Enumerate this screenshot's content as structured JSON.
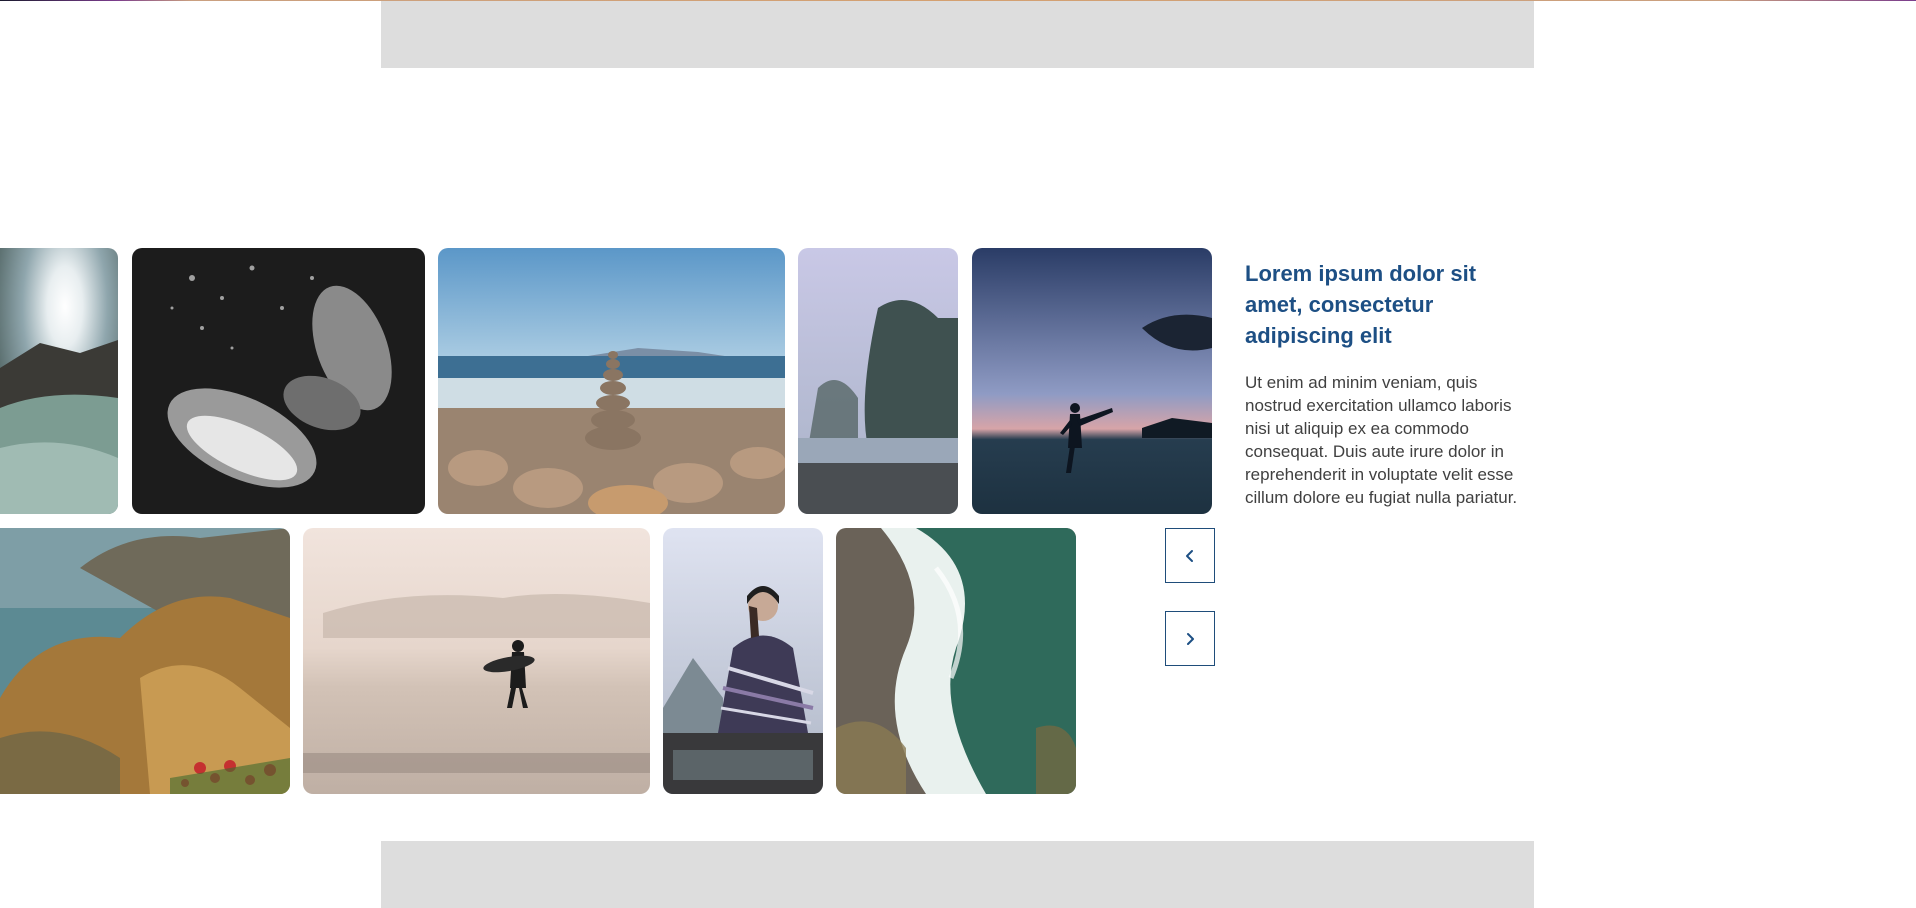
{
  "carousel": {
    "prev_icon": "chevron-left-icon",
    "next_icon": "chevron-right-icon",
    "accent_color": "#1d4f84",
    "images": [
      {
        "subject": "ocean wave splash with sun"
      },
      {
        "subject": "penguins swimming underwater black and white"
      },
      {
        "subject": "stacked stones cairn on rocky beach"
      },
      {
        "subject": "misty coastline with trees"
      },
      {
        "subject": "silhouette kicking on beach at dusk"
      },
      {
        "subject": "rocky coastal cliffs with flowers"
      },
      {
        "subject": "surfer walking on foggy beach"
      },
      {
        "subject": "person wrapped in blanket on car roof"
      },
      {
        "subject": "aerial view of waves on sandy shore"
      }
    ]
  },
  "content": {
    "heading": "Lorem ipsum dolor sit amet, consectetur adipiscing elit",
    "body": "Ut enim ad minim veniam, quis nostrud exercitation ullamco laboris nisi ut aliquip ex ea commodo consequat. Duis aute irure dolor in reprehenderit in voluptate velit esse cillum dolore eu fugiat nulla pariatur."
  }
}
